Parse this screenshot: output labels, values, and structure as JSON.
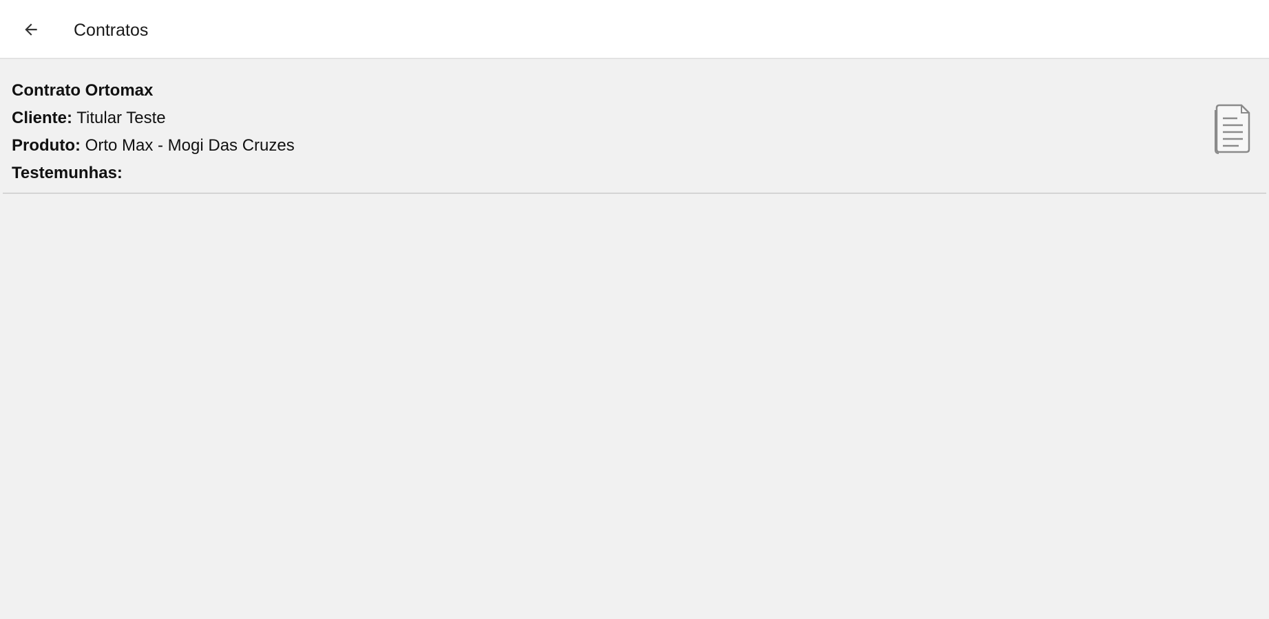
{
  "toolbar": {
    "back_icon": "arrow-left-icon",
    "title": "Contratos"
  },
  "contracts": [
    {
      "title": "Contrato Ortomax",
      "client_label": "Cliente:",
      "client_value": "Titular Teste",
      "product_label": "Produto:",
      "product_value": "Orto Max - Mogi Das Cruzes",
      "witnesses_label": "Testemunhas:",
      "icon": "document-icon"
    }
  ],
  "colors": {
    "toolbar_bg": "#ffffff",
    "page_bg": "#f1f1f1",
    "divider": "#d4d4d4"
  }
}
